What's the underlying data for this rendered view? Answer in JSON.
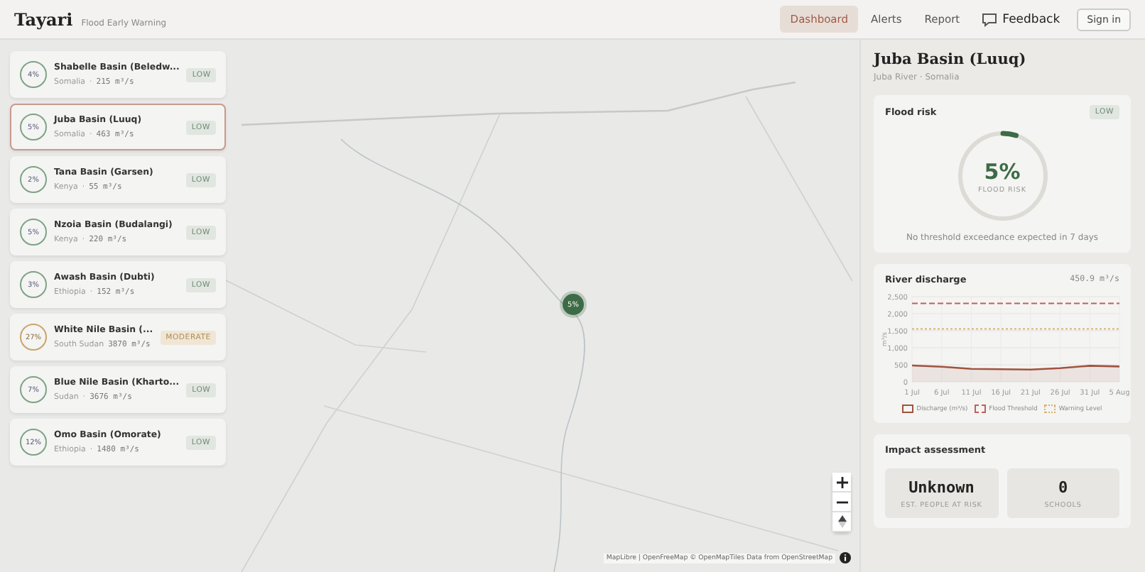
{
  "header": {
    "logo": "Tayari",
    "tagline": "Flood Early Warning",
    "nav": [
      {
        "label": "Dashboard",
        "selected": true
      },
      {
        "label": "Alerts",
        "selected": false
      },
      {
        "label": "Report",
        "selected": false
      }
    ],
    "feedback": "Feedback",
    "sign_in": "Sign in"
  },
  "basins": [
    {
      "name": "Shabelle Basin (Beledw...",
      "country": "Somalia",
      "separator": "·",
      "discharge": "215 m³/s",
      "risk": "4%",
      "level": "LOW",
      "kind": "low",
      "selected": false
    },
    {
      "name": "Juba Basin (Luuq)",
      "country": "Somalia",
      "separator": "·",
      "discharge": "463 m³/s",
      "risk": "5%",
      "level": "LOW",
      "kind": "low",
      "selected": true
    },
    {
      "name": "Tana Basin (Garsen)",
      "country": "Kenya",
      "separator": "·",
      "discharge": "55 m³/s",
      "risk": "2%",
      "level": "LOW",
      "kind": "low",
      "selected": false
    },
    {
      "name": "Nzoia Basin (Budalangi)",
      "country": "Kenya",
      "separator": "·",
      "discharge": "220 m³/s",
      "risk": "5%",
      "level": "LOW",
      "kind": "low",
      "selected": false
    },
    {
      "name": "Awash Basin (Dubti)",
      "country": "Ethiopia",
      "separator": "·",
      "discharge": "152 m³/s",
      "risk": "3%",
      "level": "LOW",
      "kind": "low",
      "selected": false
    },
    {
      "name": "White Nile Basin (...",
      "country": "South Sudan",
      "discharge": "3870 m³/s",
      "risk": "27%",
      "level": "MODERATE",
      "kind": "moderate",
      "selected": false
    },
    {
      "name": "Blue Nile Basin (Kharto...",
      "country": "Sudan",
      "separator": "·",
      "discharge": "3676 m³/s",
      "risk": "7%",
      "level": "LOW",
      "kind": "low",
      "selected": false
    },
    {
      "name": "Omo Basin (Omorate)",
      "country": "Ethiopia",
      "separator": "·",
      "discharge": "1480 m³/s",
      "risk": "12%",
      "level": "LOW",
      "kind": "low",
      "selected": false
    }
  ],
  "map": {
    "marker": "5%",
    "attribution": "MapLibre | OpenFreeMap © OpenMapTiles Data from OpenStreetMap"
  },
  "detail": {
    "title": "Juba Basin (Luuq)",
    "subtitle": "Juba River · Somalia",
    "flood_risk": {
      "heading": "Flood risk",
      "badge": "LOW",
      "kind": "low",
      "value": "5%",
      "level": 0.05,
      "caption": "FLOOD RISK",
      "note": "No threshold exceedance expected in 7 days"
    },
    "discharge": {
      "heading": "River discharge",
      "reading": "450.9 m³/s",
      "chart_data": {
        "type": "line",
        "ylabel": "m³/s",
        "categories": [
          "1 Jul",
          "6 Jul",
          "11 Jul",
          "16 Jul",
          "21 Jul",
          "26 Jul",
          "31 Jul",
          "5 Aug"
        ],
        "yticks": [
          {
            "value": 0,
            "label": "0"
          },
          {
            "value": 500,
            "label": "500"
          },
          {
            "value": 1000,
            "label": "1,000"
          },
          {
            "value": 1500,
            "label": "1,500"
          },
          {
            "value": 2000,
            "label": "2,000"
          },
          {
            "value": 2500,
            "label": "2,500"
          }
        ],
        "ylim": [
          0,
          2500
        ],
        "grid": true,
        "series": [
          {
            "name": "Discharge (m³/s)",
            "color": "#a0533e",
            "line_style": "solid",
            "values": [
              480,
              440,
              380,
              370,
              360,
              400,
              470,
              450
            ]
          },
          {
            "name": "Flood Threshold",
            "color": "#c0605a",
            "line_style": "dashed",
            "values": [
              2300,
              2300,
              2300,
              2300,
              2300,
              2300,
              2300,
              2300
            ]
          },
          {
            "name": "Warning Level",
            "color": "#d8b070",
            "line_style": "dotted",
            "values": [
              1550,
              1550,
              1550,
              1550,
              1550,
              1550,
              1550,
              1550
            ]
          }
        ]
      }
    },
    "impact": {
      "heading": "Impact assessment",
      "stats": [
        {
          "value": "Unknown",
          "label": "EST. PEOPLE AT RISK"
        },
        {
          "value": "0",
          "label": "SCHOOLS"
        }
      ]
    }
  }
}
